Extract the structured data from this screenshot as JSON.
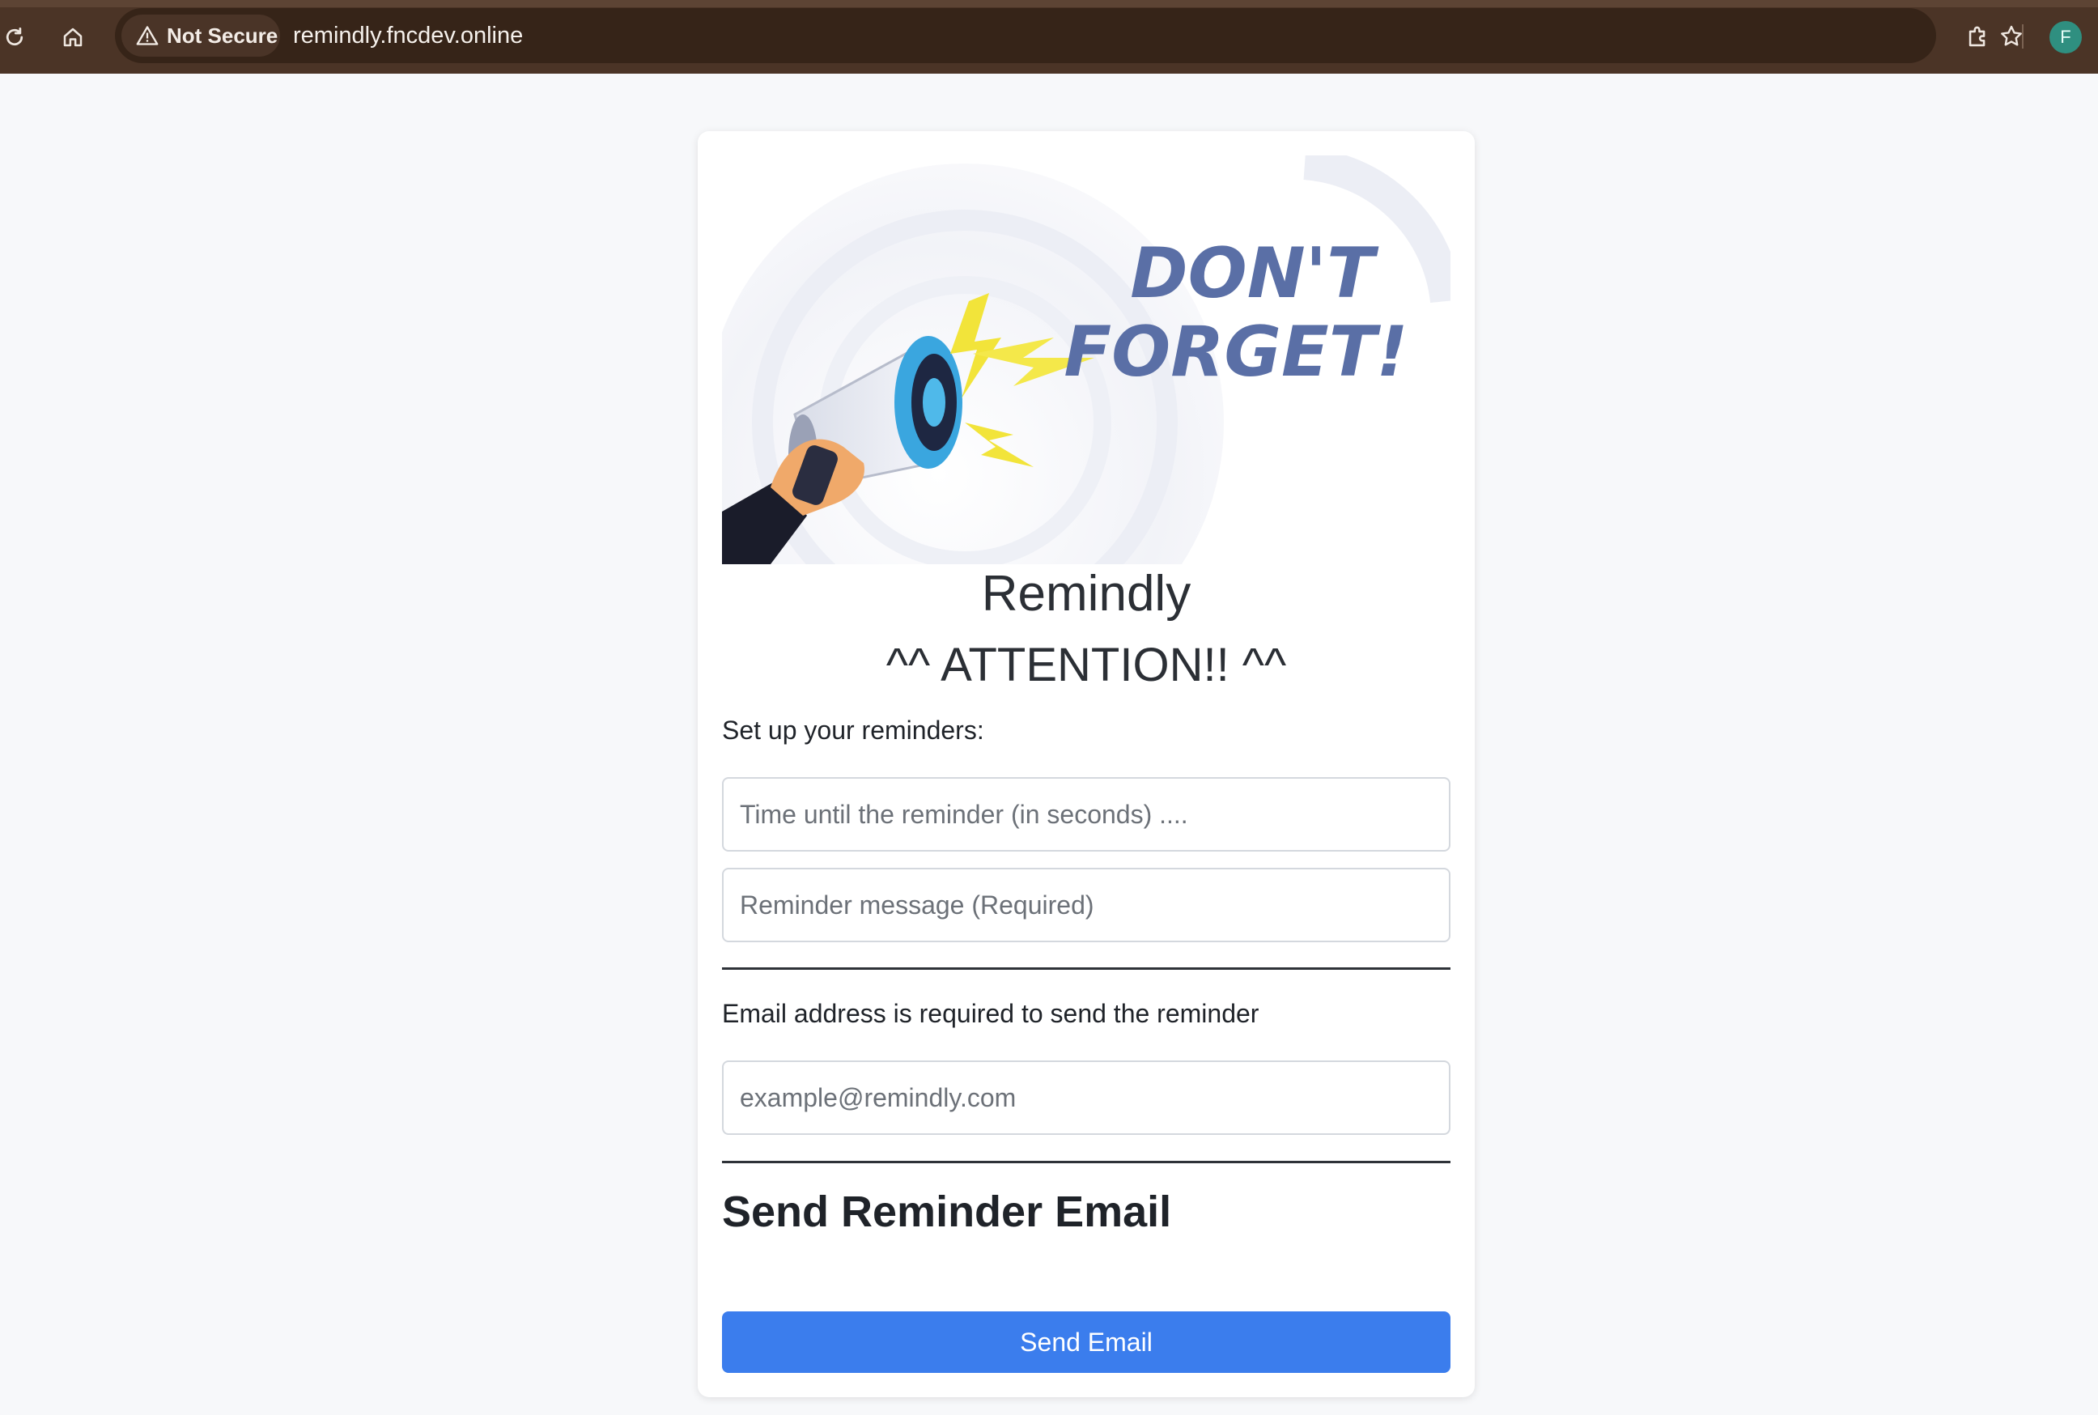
{
  "browser": {
    "security_label": "Not Secure",
    "url": "remindly.fncdev.online",
    "profile_initial": "F"
  },
  "hero": {
    "headline_line1": "DON'T",
    "headline_line2": "FORGET!",
    "icon": "megaphone-icon"
  },
  "app": {
    "title": "Remindly",
    "attention": "^^ ATTENTION!! ^^",
    "setup_label": "Set up your reminders:",
    "time_placeholder": "Time until the reminder (in seconds) ....",
    "message_placeholder": "Reminder message (Required)",
    "email_label": "Email address is required to send the reminder",
    "email_placeholder": "example@remindly.com",
    "send_heading": "Send Reminder Email",
    "send_button": "Send Email"
  },
  "colors": {
    "chrome_bg": "#4b3426",
    "omnibox_bg": "#362418",
    "accent_button": "#3b7ded",
    "avatar": "#2f8f80"
  }
}
